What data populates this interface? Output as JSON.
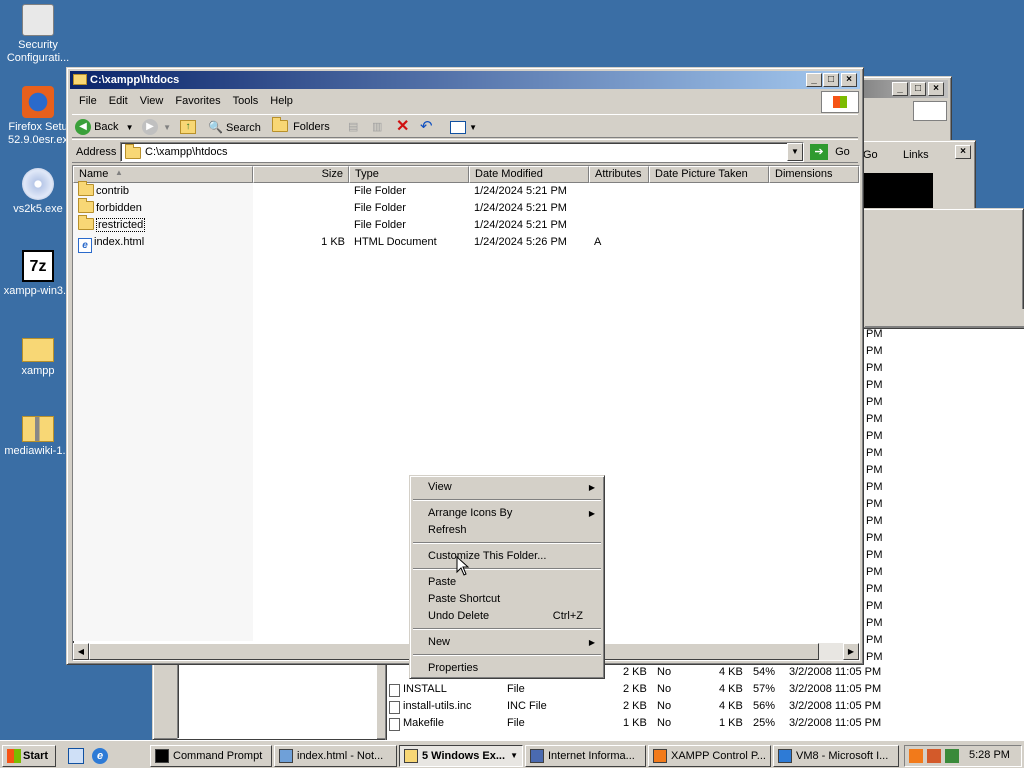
{
  "desktop": {
    "icons": [
      {
        "label1": "Security",
        "label2": "Configurati...",
        "icon": "security-config-icon"
      },
      {
        "label1": "Firefox Setu",
        "label2": "52.9.0esr.ex",
        "icon": "firefox-setup-icon"
      },
      {
        "label1": "vs2k5.exe",
        "label2": "",
        "icon": "cd-disc-icon"
      },
      {
        "label1": "xampp-win3...",
        "label2": "",
        "icon": "7zip-icon",
        "glyph": "7z"
      },
      {
        "label1": "xampp",
        "label2": "",
        "icon": "folder-icon"
      },
      {
        "label1": "mediawiki-1...",
        "label2": "",
        "icon": "zip-folder-icon"
      }
    ]
  },
  "explorer": {
    "title": "C:\\xampp\\htdocs",
    "menu": [
      "File",
      "Edit",
      "View",
      "Favorites",
      "Tools",
      "Help"
    ],
    "toolbar": {
      "back": "Back",
      "search": "Search",
      "folders": "Folders"
    },
    "address_label": "Address",
    "address_value": "C:\\xampp\\htdocs",
    "go": "Go",
    "columns": [
      "Name",
      "Size",
      "Type",
      "Date Modified",
      "Attributes",
      "Date Picture Taken",
      "Dimensions"
    ],
    "files": [
      {
        "name": "contrib",
        "size": "",
        "type": "File Folder",
        "modified": "1/24/2024 5:21 PM",
        "attr": ""
      },
      {
        "name": "forbidden",
        "size": "",
        "type": "File Folder",
        "modified": "1/24/2024 5:21 PM",
        "attr": ""
      },
      {
        "name": "restricted",
        "size": "",
        "type": "File Folder",
        "modified": "1/24/2024 5:21 PM",
        "attr": ""
      },
      {
        "name": "index.html",
        "size": "1 KB",
        "type": "HTML Document",
        "modified": "1/24/2024 5:26 PM",
        "attr": "A"
      }
    ]
  },
  "context_menu": {
    "items": [
      {
        "label": "View",
        "submenu": true
      },
      {
        "sep": true
      },
      {
        "label": "Arrange Icons By",
        "submenu": true
      },
      {
        "label": "Refresh"
      },
      {
        "sep": true
      },
      {
        "label": "Customize This Folder..."
      },
      {
        "sep": true
      },
      {
        "label": "Paste"
      },
      {
        "label": "Paste Shortcut"
      },
      {
        "label": "Undo Delete",
        "shortcut": "Ctrl+Z"
      },
      {
        "sep": true
      },
      {
        "label": "New",
        "submenu": true
      },
      {
        "sep": true
      },
      {
        "label": "Properties"
      }
    ]
  },
  "background_window": {
    "go": "Go",
    "links": "Links",
    "pm_suffix": "PM",
    "rows": [
      {
        "name": "INSTALL",
        "type": "File",
        "size": "2 KB",
        "flag": "No",
        "csize": "4 KB",
        "ratio": "57%",
        "date": "3/2/2008 11:05 PM"
      },
      {
        "name": "install-utils.inc",
        "type": "INC File",
        "size": "2 KB",
        "flag": "No",
        "csize": "4 KB",
        "ratio": "56%",
        "date": "3/2/2008 11:05 PM"
      },
      {
        "name": "Makefile",
        "type": "File",
        "size": "1 KB",
        "flag": "No",
        "csize": "1 KB",
        "ratio": "25%",
        "date": "3/2/2008 11:05 PM"
      }
    ],
    "partial_row": {
      "size": "2 KB",
      "flag": "No",
      "csize": "4 KB",
      "ratio": "54%",
      "date": "3/2/2008 11:05 PM"
    }
  },
  "taskbar": {
    "start": "Start",
    "tasks": [
      {
        "label": "Command Prompt",
        "icon": "cmd-icon"
      },
      {
        "label": "index.html - Not...",
        "icon": "notepad-icon"
      },
      {
        "label": "5 Windows Ex...",
        "icon": "folder-icon",
        "pressed": true
      },
      {
        "label": "Internet Informa...",
        "icon": "iis-icon"
      },
      {
        "label": "XAMPP Control P...",
        "icon": "xampp-icon"
      },
      {
        "label": "VM8 - Microsoft I...",
        "icon": "ie-icon"
      }
    ],
    "clock": "5:28 PM"
  }
}
